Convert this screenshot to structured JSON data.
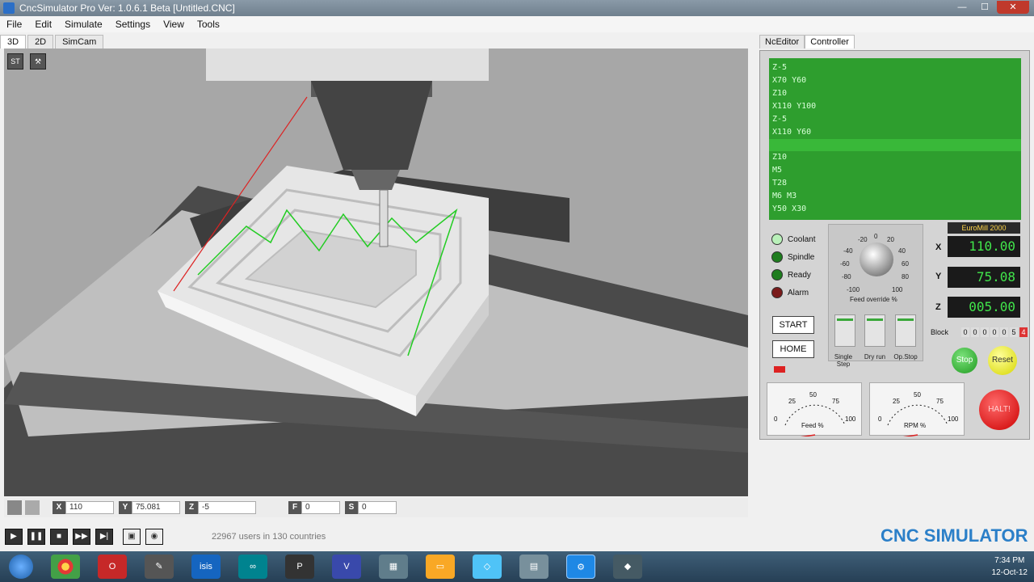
{
  "window": {
    "title": "CncSimulator Pro Ver: 1.0.6.1 Beta  [Untitled.CNC]"
  },
  "menu": [
    "File",
    "Edit",
    "Simulate",
    "Settings",
    "View",
    "Tools"
  ],
  "view_tabs": [
    "3D",
    "2D",
    "SimCam"
  ],
  "right_tabs": [
    "NcEditor",
    "Controller"
  ],
  "gcode_lines": [
    "Z-5",
    "X70 Y60",
    "Z10",
    "X110 Y100",
    "Z-5",
    "X110 Y60",
    "",
    "Z10",
    "M5",
    "T28",
    "M6 M3",
    "Y50 X30"
  ],
  "gcode_highlight_index": 6,
  "indicators": [
    {
      "label": "Coolant",
      "color": "#b9f0b9"
    },
    {
      "label": "Spindle",
      "color": "#1e7d1e"
    },
    {
      "label": "Ready",
      "color": "#1e7d1e"
    },
    {
      "label": "Alarm",
      "color": "#7a1a1a"
    }
  ],
  "feed_dial": {
    "ticks": [
      "-20",
      "0",
      "20",
      "-40",
      "40",
      "-60",
      "60",
      "-80",
      "80",
      "-100",
      "100"
    ],
    "label": "Feed override %"
  },
  "buttons": {
    "start": "START",
    "home": "HOME"
  },
  "switches": [
    "Single Step",
    "Dry run",
    "Op.Stop"
  ],
  "machine": {
    "name": "EuroMill 2000"
  },
  "axes": [
    {
      "label": "X",
      "value": "110.00"
    },
    {
      "label": "Y",
      "value": "75.08"
    },
    {
      "label": "Z",
      "value": "005.00"
    }
  ],
  "block": {
    "label": "Block",
    "digits": [
      "0",
      "0",
      "0",
      "0",
      "0",
      "5",
      "4"
    ]
  },
  "round_buttons": {
    "stop": "Stop",
    "reset": "Reset",
    "halt": "HALT!"
  },
  "gauges": [
    {
      "label": "Feed %",
      "ticks": [
        "0",
        "25",
        "50",
        "75",
        "100"
      ],
      "value": 0
    },
    {
      "label": "RPM %",
      "ticks": [
        "0",
        "25",
        "50",
        "75",
        "100"
      ],
      "value": 0
    }
  ],
  "coords": {
    "x": "110",
    "y": "75.081",
    "z": "-5",
    "f": "0",
    "s": "0"
  },
  "coord_labels": {
    "x": "X",
    "y": "Y",
    "z": "Z",
    "f": "F",
    "s": "S"
  },
  "status": {
    "users": "22967 users in 130 countries"
  },
  "brand_logo": "CNC SIMULATOR",
  "clock": {
    "time": "7:34 PM",
    "date": "12-Oct-12"
  },
  "taskbar_apps": [
    "start-orb",
    "chrome",
    "opera",
    "app-tool",
    "isis",
    "arduino",
    "proteus",
    "visio",
    "calculator",
    "explorer",
    "app-window",
    "app-folder",
    "cnc-simulator",
    "app-box"
  ]
}
